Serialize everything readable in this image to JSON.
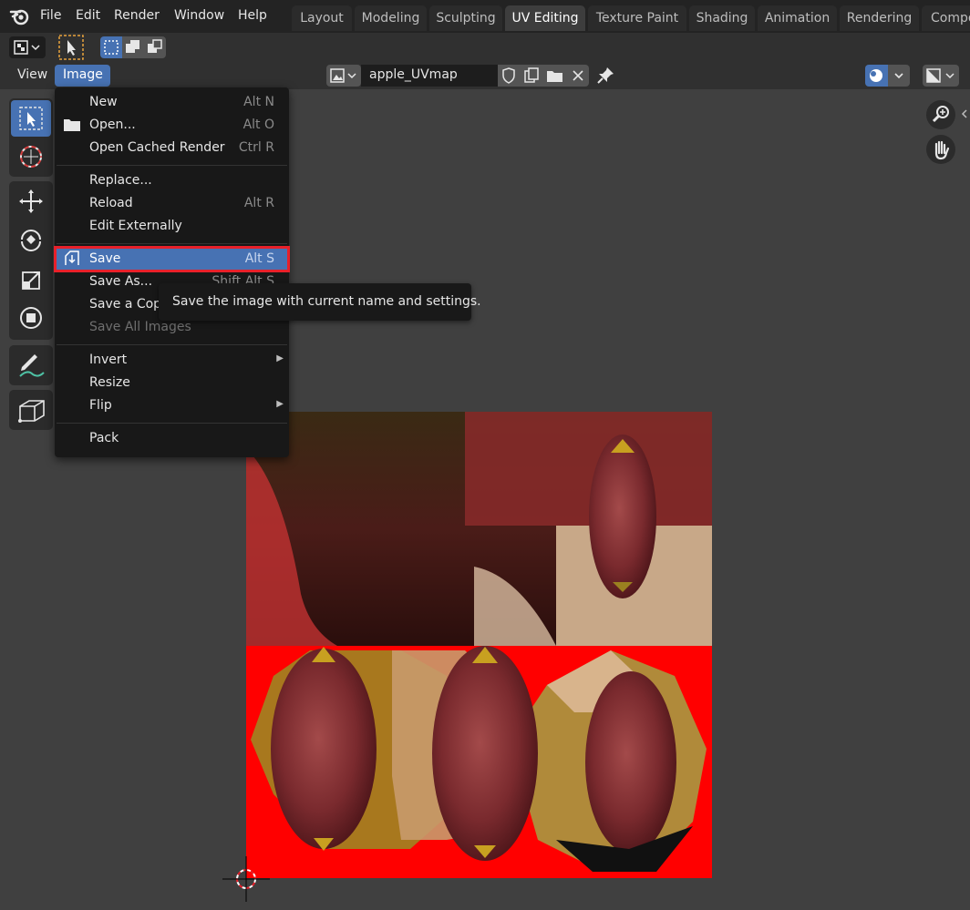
{
  "topbar": {
    "menus": [
      "File",
      "Edit",
      "Render",
      "Window",
      "Help"
    ],
    "workspaces": [
      "Layout",
      "Modeling",
      "Sculpting",
      "UV Editing",
      "Texture Paint",
      "Shading",
      "Animation",
      "Rendering",
      "Compo"
    ],
    "active_workspace": "UV Editing"
  },
  "header": {
    "view_label": "View",
    "image_label": "Image",
    "image_name": "apple_UVmap"
  },
  "image_menu": {
    "items": [
      {
        "label": "New",
        "shortcut": "Alt N"
      },
      {
        "label": "Open...",
        "shortcut": "Alt O"
      },
      {
        "label": "Open Cached Render",
        "shortcut": "Ctrl R"
      },
      {
        "label": "Replace...",
        "shortcut": ""
      },
      {
        "label": "Reload",
        "shortcut": "Alt R"
      },
      {
        "label": "Edit Externally",
        "shortcut": ""
      },
      {
        "label": "Save",
        "shortcut": "Alt S"
      },
      {
        "label": "Save As...",
        "shortcut": "Shift Alt S"
      },
      {
        "label": "Save a Copy...",
        "shortcut": ""
      },
      {
        "label": "Save All Images",
        "shortcut": ""
      },
      {
        "label": "Invert",
        "shortcut": ""
      },
      {
        "label": "Resize",
        "shortcut": ""
      },
      {
        "label": "Flip",
        "shortcut": ""
      },
      {
        "label": "Pack",
        "shortcut": ""
      }
    ]
  },
  "tooltip": {
    "text": "Save the image with current name and settings."
  },
  "colors": {
    "accent": "#4772b3",
    "highlight_box": "#e8202a",
    "menu_bg": "#181818",
    "viewport_bg": "#404040"
  }
}
